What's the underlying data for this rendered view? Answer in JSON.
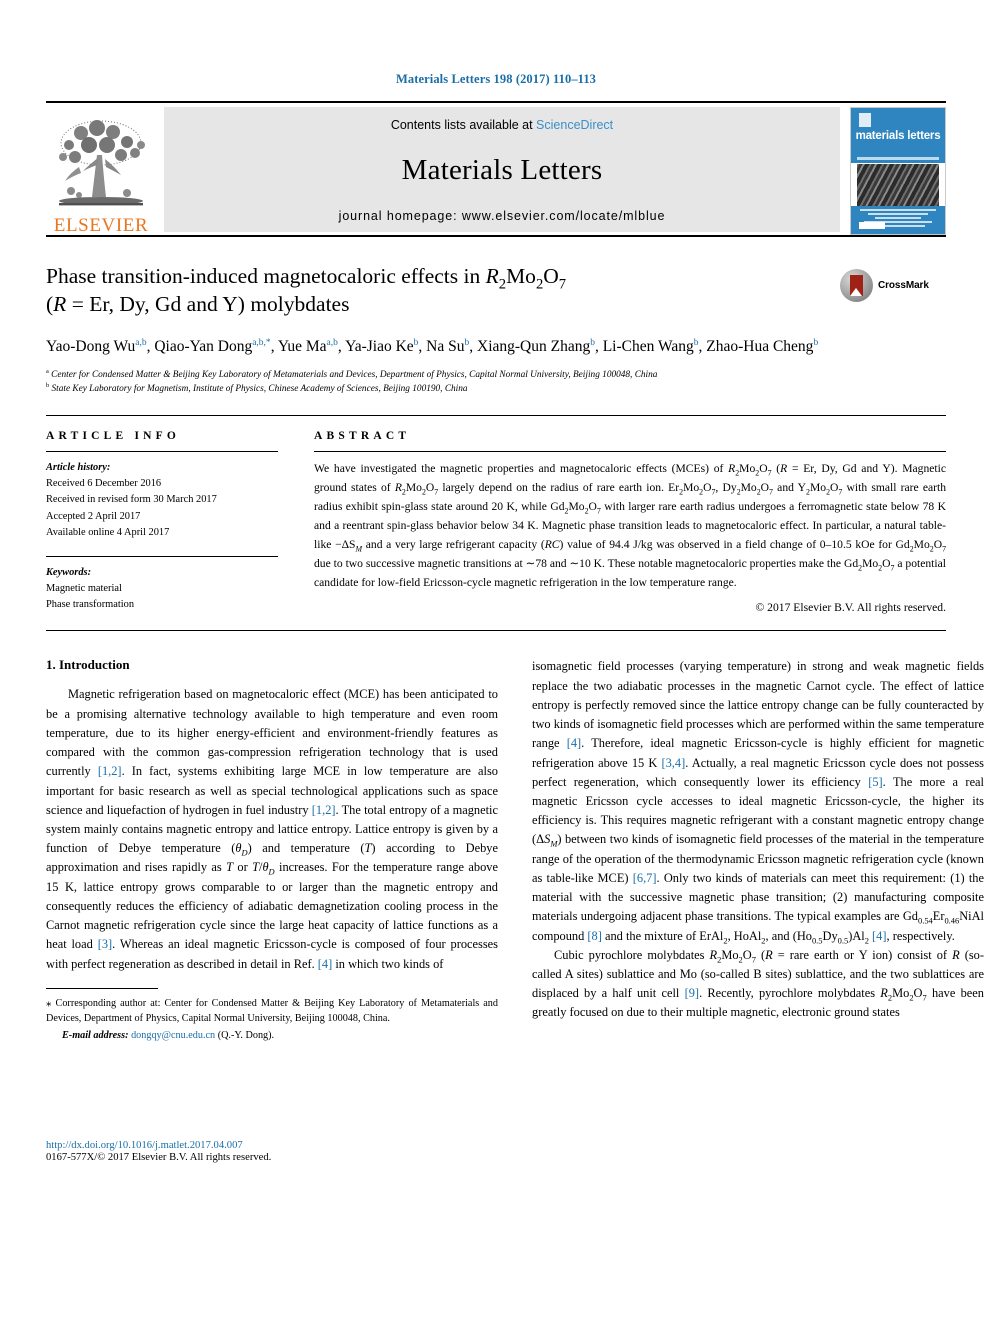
{
  "running_head": "Materials Letters 198 (2017) 110–113",
  "masthead": {
    "publisher_name": "ELSEVIER",
    "contents_prefix": "Contents lists available at ",
    "sciencedirect": "ScienceDirect",
    "journal_title": "Materials Letters",
    "homepage_prefix": "journal homepage: ",
    "homepage_url": "www.elsevier.com/locate/mlblue",
    "cover_title": "materials letters"
  },
  "article": {
    "title_line1_a": "Phase transition-induced magnetocaloric effects in ",
    "title_line1_formula": "R2Mo2O7",
    "title_line2": "(R = Er, Dy, Gd and Y) molybdates",
    "crossmark_label": "CrossMark",
    "authors": [
      {
        "name": "Yao-Dong Wu",
        "aff": "a,b",
        "sep": ", "
      },
      {
        "name": "Qiao-Yan Dong",
        "aff": "a,b,*",
        "sep": ", "
      },
      {
        "name": "Yue Ma",
        "aff": "a,b",
        "sep": ", "
      },
      {
        "name": "Ya-Jiao Ke",
        "aff": "b",
        "sep": ", "
      },
      {
        "name": "Na Su",
        "aff": "b",
        "sep": ", "
      },
      {
        "name": "Xiang-Qun Zhang",
        "aff": "b",
        "sep": ", "
      },
      {
        "name": "Li-Chen Wang",
        "aff": "b",
        "sep": ","
      },
      {
        "name": "Zhao-Hua Cheng",
        "aff": "b",
        "sep": ""
      }
    ],
    "affiliations": [
      {
        "marker": "a",
        "text": "Center for Condensed Matter & Beijing Key Laboratory of Metamaterials and Devices, Department of Physics, Capital Normal University, Beijing 100048, China"
      },
      {
        "marker": "b",
        "text": "State Key Laboratory for Magnetism, Institute of Physics, Chinese Academy of Sciences, Beijing 100190, China"
      }
    ]
  },
  "article_info": {
    "heading": "ARTICLE INFO",
    "history_label": "Article history:",
    "history": [
      "Received 6 December 2016",
      "Received in revised form 30 March 2017",
      "Accepted 2 April 2017",
      "Available online 4 April 2017"
    ],
    "keywords_label": "Keywords:",
    "keywords": [
      "Magnetic material",
      "Phase transformation"
    ]
  },
  "abstract": {
    "heading": "ABSTRACT",
    "copyright": "© 2017 Elsevier B.V. All rights reserved."
  },
  "introduction": {
    "heading": "1. Introduction"
  },
  "footnote": {
    "star": "⁎",
    "corresponding_label": " Corresponding author at: ",
    "corresponding_text": "Center for Condensed Matter & Beijing Key Laboratory of Metamaterials and Devices, Department of Physics, Capital Normal University, Beijing 100048, China.",
    "email_label": "E-mail address:",
    "email": "dongqy@cnu.edu.cn",
    "email_owner": "(Q.-Y. Dong)."
  },
  "footer": {
    "doi": "http://dx.doi.org/10.1016/j.matlet.2017.04.007",
    "issn": "0167-577X/© 2017 Elsevier B.V. All rights reserved."
  },
  "colors": {
    "link": "#1a6ea8",
    "elsevier_orange": "#E87722",
    "cover_blue": "#2f85c0"
  }
}
